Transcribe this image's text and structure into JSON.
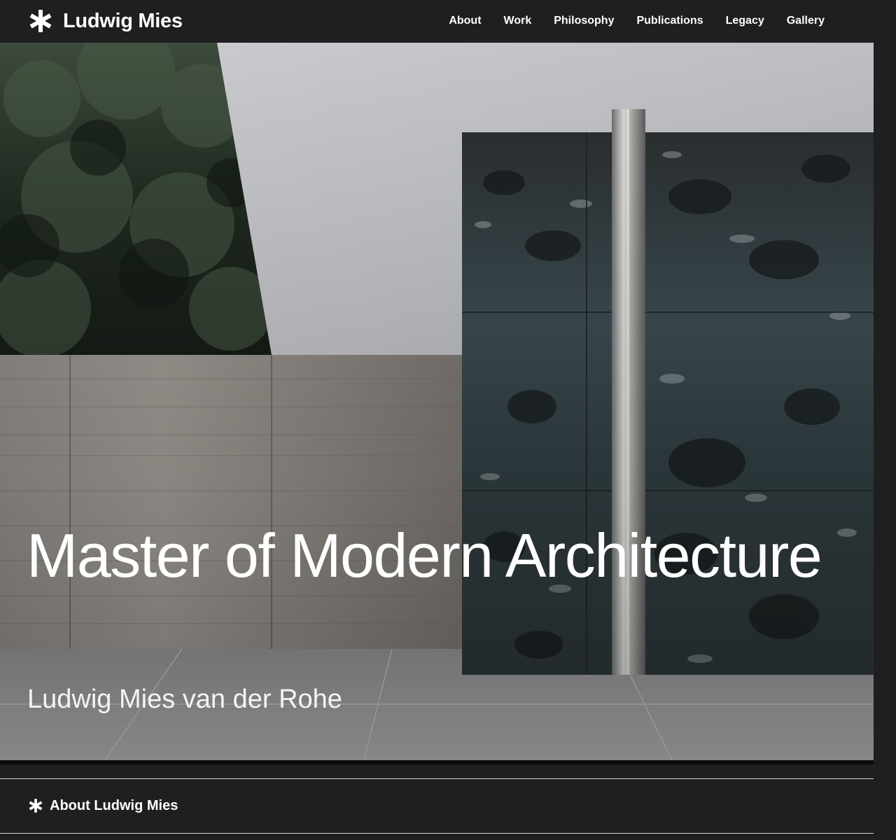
{
  "header": {
    "brand_icon": "asterisk-icon",
    "brand_name": "Ludwig Mies",
    "nav": [
      {
        "label": "About"
      },
      {
        "label": "Work"
      },
      {
        "label": "Philosophy"
      },
      {
        "label": "Publications"
      },
      {
        "label": "Legacy"
      },
      {
        "label": "Gallery"
      }
    ]
  },
  "hero": {
    "title": "Master of Modern Architecture",
    "subtitle": "Ludwig Mies van der Rohe"
  },
  "section": {
    "icon": "asterisk-icon",
    "heading": "About Ludwig Mies"
  },
  "colors": {
    "background": "#1e1f21",
    "text": "#ffffff",
    "divider": "#d9d9d9"
  }
}
